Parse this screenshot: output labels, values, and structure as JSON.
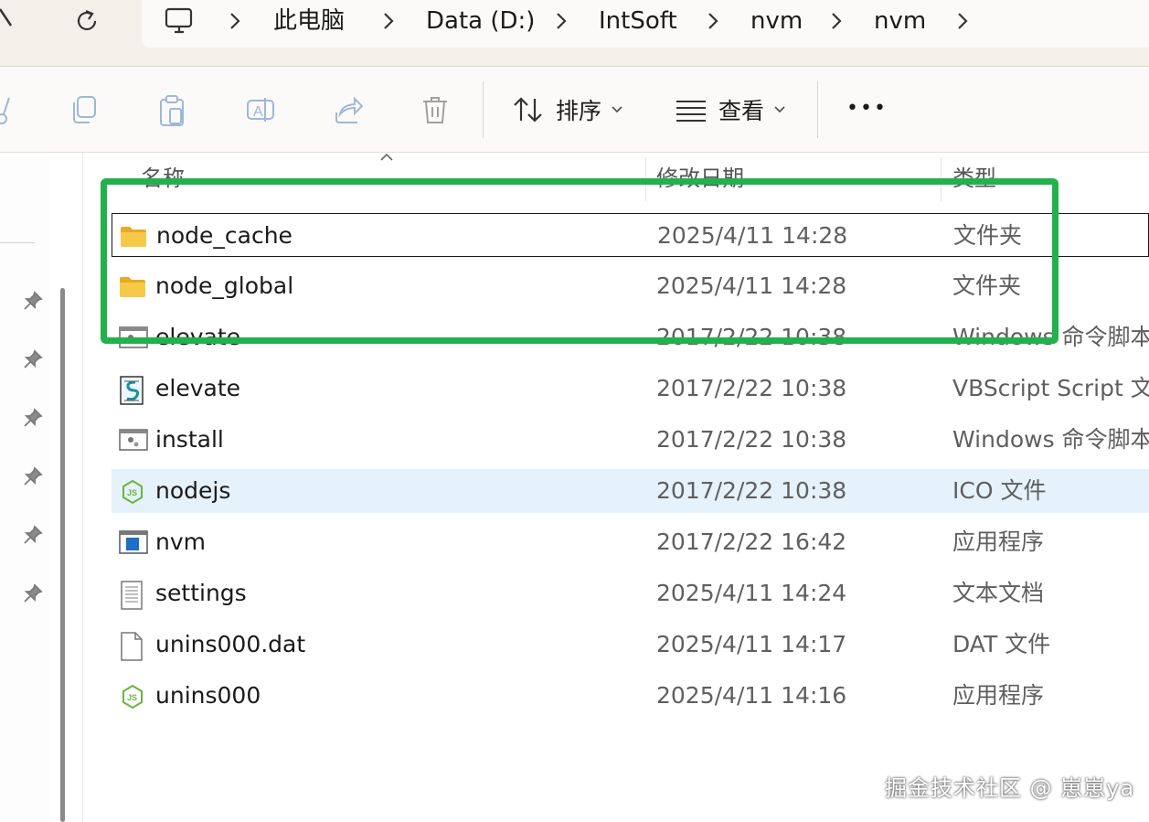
{
  "address_bar": {
    "breadcrumbs": [
      "此电脑",
      "Data (D:)",
      "IntSoft",
      "nvm",
      "nvm"
    ],
    "icons": [
      "back-icon",
      "refresh-icon",
      "computer-icon",
      "chevron-right-icon"
    ]
  },
  "toolbar": {
    "sort_label": "排序",
    "view_label": "查看",
    "more_label": "•••",
    "icons": [
      "cut-icon",
      "copy-icon",
      "paste-icon",
      "rename-icon",
      "share-icon",
      "delete-icon",
      "sort-icon",
      "view-icon"
    ]
  },
  "list": {
    "headers": {
      "name": "名称",
      "date": "修改日期",
      "type": "类型"
    },
    "rows": [
      {
        "name": "node_cache",
        "date": "2025/4/11 14:28",
        "type": "文件夹",
        "icon": "folder-icon"
      },
      {
        "name": "node_global",
        "date": "2025/4/11 14:28",
        "type": "文件夹",
        "icon": "folder-icon"
      },
      {
        "name": "elevate",
        "date": "2017/2/22 10:38",
        "type": "Windows 命令脚本",
        "icon": "batch-file-icon"
      },
      {
        "name": "elevate",
        "date": "2017/2/22 10:38",
        "type": "VBScript Script 文件",
        "icon": "vbscript-file-icon"
      },
      {
        "name": "install",
        "date": "2017/2/22 10:38",
        "type": "Windows 命令脚本",
        "icon": "batch-file-icon"
      },
      {
        "name": "nodejs",
        "date": "2017/2/22 10:38",
        "type": "ICO 文件",
        "icon": "nodejs-icon"
      },
      {
        "name": "nvm",
        "date": "2017/2/22 16:42",
        "type": "应用程序",
        "icon": "application-icon"
      },
      {
        "name": "settings",
        "date": "2025/4/11 14:24",
        "type": "文本文档",
        "icon": "text-file-icon"
      },
      {
        "name": "unins000.dat",
        "date": "2025/4/11 14:17",
        "type": "DAT 文件",
        "icon": "blank-file-icon"
      },
      {
        "name": "unins000",
        "date": "2025/4/11 14:16",
        "type": "应用程序",
        "icon": "nodejs-icon"
      }
    ]
  },
  "watermark": "掘金技术社区 @ 崽崽ya",
  "colors": {
    "highlight": "#22b14c",
    "hover_row": "#e5f1fb",
    "folder": "#f7c948"
  }
}
